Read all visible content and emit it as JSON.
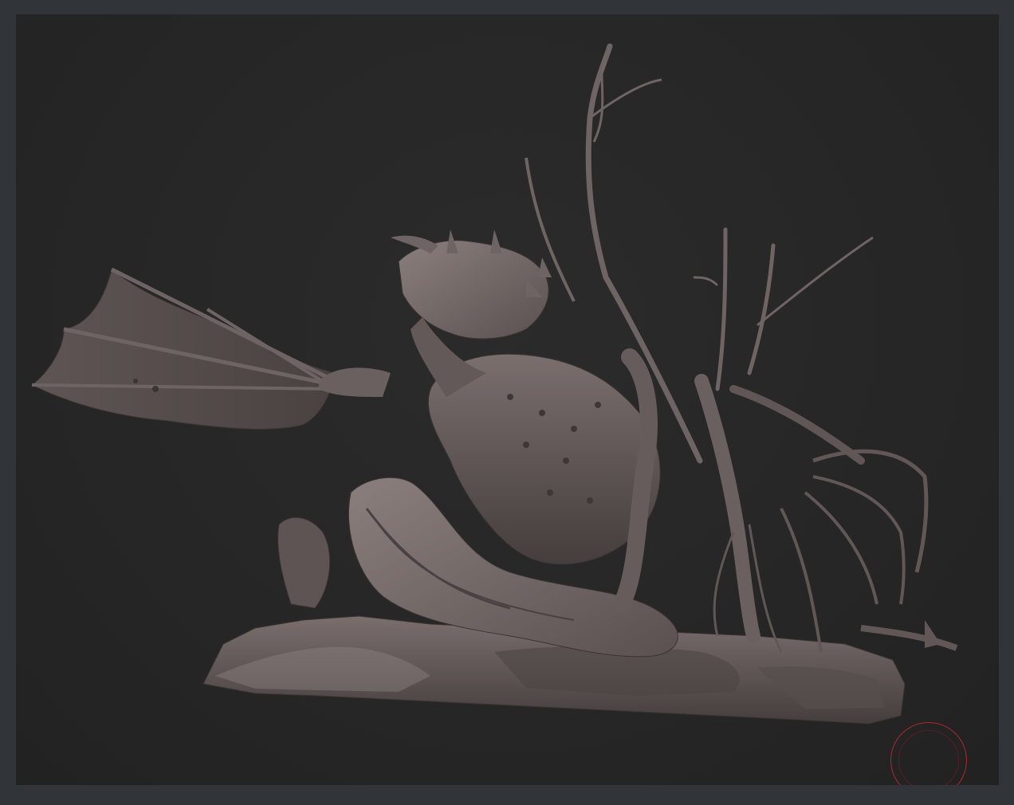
{
  "app": {
    "viewport_background": "#262626",
    "frame_color": "#31353a",
    "material_color": "#6b6160",
    "brush_cursor_color": "#b3272d"
  },
  "canvas": {
    "model": "dragon-sculpt-model",
    "brush_cursor_icon": "brush-circle-icon"
  }
}
